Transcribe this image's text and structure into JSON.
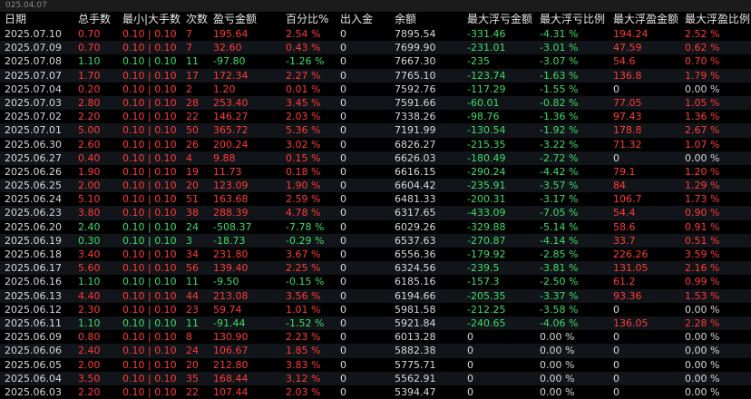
{
  "topbar": {
    "label": "025.04.07"
  },
  "colors": {
    "red": "#ff3b3b",
    "green": "#3ddc6a",
    "neutral": "#d8d8d8",
    "background": "#000000"
  },
  "table": {
    "columns": [
      "日期",
      "总手数",
      "最小|大手数",
      "次数",
      "盈亏金额",
      "百分比%",
      "出入金",
      "余额",
      "最大浮亏金额",
      "最大浮亏比例",
      "最大浮盈金额",
      "最大浮盈比例"
    ],
    "rows": [
      [
        "2025.07.10",
        "0.70",
        "0.10 | 0.10",
        "7",
        "195.64",
        "2.54 %",
        "0",
        "7895.54",
        "-331.46",
        "-4.31 %",
        "194.24",
        "2.52 %"
      ],
      [
        "2025.07.09",
        "0.70",
        "0.10 | 0.10",
        "7",
        "32.60",
        "0.43 %",
        "0",
        "7699.90",
        "-231.01",
        "-3.01 %",
        "47.59",
        "0.62 %"
      ],
      [
        "2025.07.08",
        "1.10",
        "0.10 | 0.10",
        "11",
        "-97.80",
        "-1.26 %",
        "0",
        "7667.30",
        "-235",
        "-3.07 %",
        "54.6",
        "0.70 %"
      ],
      [
        "2025.07.07",
        "1.70",
        "0.10 | 0.10",
        "17",
        "172.34",
        "2.27 %",
        "0",
        "7765.10",
        "-123.74",
        "-1.63 %",
        "136.8",
        "1.79 %"
      ],
      [
        "2025.07.04",
        "0.20",
        "0.10 | 0.10",
        "2",
        "1.20",
        "0.01 %",
        "0",
        "7592.76",
        "-117.29",
        "-1.55 %",
        "0",
        "0.00 %"
      ],
      [
        "2025.07.03",
        "2.80",
        "0.10 | 0.10",
        "28",
        "253.40",
        "3.45 %",
        "0",
        "7591.66",
        "-60.01",
        "-0.82 %",
        "77.05",
        "1.05 %"
      ],
      [
        "2025.07.02",
        "2.20",
        "0.10 | 0.10",
        "22",
        "146.27",
        "2.03 %",
        "0",
        "7338.26",
        "-98.76",
        "-1.36 %",
        "97.43",
        "1.36 %"
      ],
      [
        "2025.07.01",
        "5.00",
        "0.10 | 0.10",
        "50",
        "365.72",
        "5.36 %",
        "0",
        "7191.99",
        "-130.54",
        "-1.92 %",
        "178.8",
        "2.67 %"
      ],
      [
        "2025.06.30",
        "2.60",
        "0.10 | 0.10",
        "26",
        "200.24",
        "3.02 %",
        "0",
        "6826.27",
        "-215.35",
        "-3.22 %",
        "71.32",
        "1.07 %"
      ],
      [
        "2025.06.27",
        "0.40",
        "0.10 | 0.10",
        "4",
        "9.88",
        "0.15 %",
        "0",
        "6626.03",
        "-180.49",
        "-2.72 %",
        "0",
        "0.00 %"
      ],
      [
        "2025.06.26",
        "1.90",
        "0.10 | 0.10",
        "19",
        "11.73",
        "0.18 %",
        "0",
        "6616.15",
        "-290.24",
        "-4.42 %",
        "79.1",
        "1.20 %"
      ],
      [
        "2025.06.25",
        "2.00",
        "0.10 | 0.10",
        "20",
        "123.09",
        "1.90 %",
        "0",
        "6604.42",
        "-235.91",
        "-3.57 %",
        "84",
        "1.29 %"
      ],
      [
        "2025.06.24",
        "5.10",
        "0.10 | 0.10",
        "51",
        "163.68",
        "2.59 %",
        "0",
        "6481.33",
        "-200.31",
        "-3.17 %",
        "106.7",
        "1.73 %"
      ],
      [
        "2025.06.23",
        "3.80",
        "0.10 | 0.10",
        "38",
        "288.39",
        "4.78 %",
        "0",
        "6317.65",
        "-433.09",
        "-7.05 %",
        "54.4",
        "0.90 %"
      ],
      [
        "2025.06.20",
        "2.40",
        "0.10 | 0.10",
        "24",
        "-508.37",
        "-7.78 %",
        "0",
        "6029.26",
        "-329.88",
        "-5.14 %",
        "58.6",
        "0.91 %"
      ],
      [
        "2025.06.19",
        "0.30",
        "0.10 | 0.10",
        "3",
        "-18.73",
        "-0.29 %",
        "0",
        "6537.63",
        "-270.87",
        "-4.14 %",
        "33.7",
        "0.51 %"
      ],
      [
        "2025.06.18",
        "3.40",
        "0.10 | 0.10",
        "34",
        "231.80",
        "3.67 %",
        "0",
        "6556.36",
        "-179.92",
        "-2.85 %",
        "226.26",
        "3.59 %"
      ],
      [
        "2025.06.17",
        "5.60",
        "0.10 | 0.10",
        "56",
        "139.40",
        "2.25 %",
        "0",
        "6324.56",
        "-239.5",
        "-3.81 %",
        "131.05",
        "2.16 %"
      ],
      [
        "2025.06.16",
        "1.10",
        "0.10 | 0.10",
        "11",
        "-9.50",
        "-0.15 %",
        "0",
        "6185.16",
        "-157.3",
        "-2.50 %",
        "61.2",
        "0.99 %"
      ],
      [
        "2025.06.13",
        "4.40",
        "0.10 | 0.10",
        "44",
        "213.08",
        "3.56 %",
        "0",
        "6194.66",
        "-205.35",
        "-3.37 %",
        "93.36",
        "1.53 %"
      ],
      [
        "2025.06.12",
        "2.30",
        "0.10 | 0.10",
        "23",
        "59.74",
        "1.01 %",
        "0",
        "5981.58",
        "-212.25",
        "-3.58 %",
        "0",
        "0.00 %"
      ],
      [
        "2025.06.11",
        "1.10",
        "0.10 | 0.10",
        "11",
        "-91.44",
        "-1.52 %",
        "0",
        "5921.84",
        "-240.65",
        "-4.06 %",
        "136.05",
        "2.28 %"
      ],
      [
        "2025.06.09",
        "0.80",
        "0.10 | 0.10",
        "8",
        "130.90",
        "2.23 %",
        "0",
        "6013.28",
        "0",
        "0.00 %",
        "0",
        "0.00 %"
      ],
      [
        "2025.06.06",
        "2.40",
        "0.10 | 0.10",
        "24",
        "106.67",
        "1.85 %",
        "0",
        "5882.38",
        "0",
        "0.00 %",
        "0",
        "0.00 %"
      ],
      [
        "2025.06.05",
        "2.00",
        "0.10 | 0.10",
        "20",
        "212.80",
        "3.83 %",
        "0",
        "5775.71",
        "0",
        "0.00 %",
        "0",
        "0.00 %"
      ],
      [
        "2025.06.04",
        "3.50",
        "0.10 | 0.10",
        "35",
        "168.44",
        "3.12 %",
        "0",
        "5562.91",
        "0",
        "0.00 %",
        "0",
        "0.00 %"
      ],
      [
        "2025.06.03",
        "2.20",
        "0.10 | 0.10",
        "22",
        "107.44",
        "2.03 %",
        "0",
        "5394.47",
        "0",
        "0.00 %",
        "0",
        "0.00 %"
      ]
    ]
  }
}
